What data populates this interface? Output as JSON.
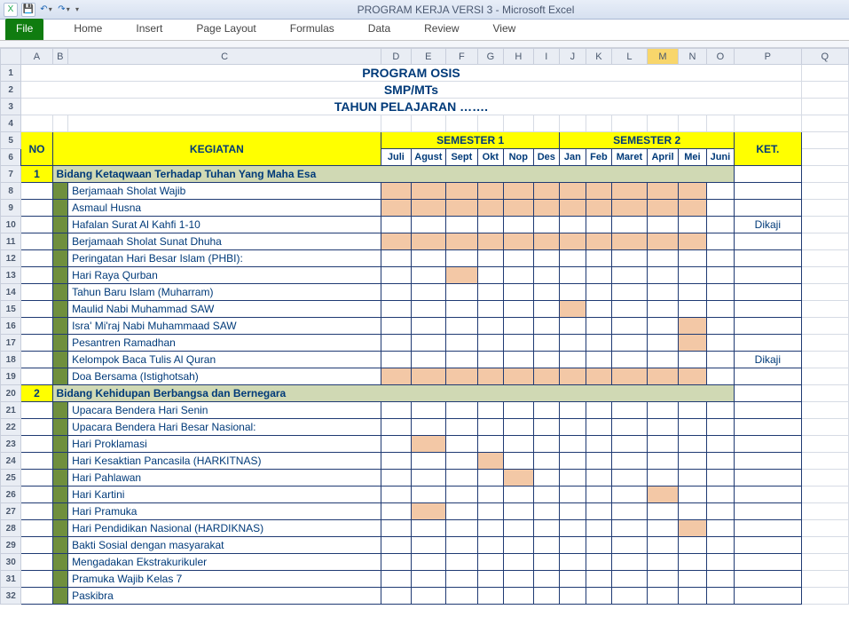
{
  "window": {
    "title": "PROGRAM KERJA VERSI 3  -  Microsoft Excel"
  },
  "ribbon": {
    "tabs": {
      "file": "File",
      "home": "Home",
      "insert": "Insert",
      "pageLayout": "Page Layout",
      "formulas": "Formulas",
      "data": "Data",
      "review": "Review",
      "view": "View"
    }
  },
  "cols": [
    "A",
    "B",
    "C",
    "D",
    "E",
    "F",
    "G",
    "H",
    "I",
    "J",
    "K",
    "L",
    "M",
    "N",
    "O",
    "P",
    "Q"
  ],
  "selectedCol": "M",
  "title1": "PROGRAM OSIS",
  "title2": "SMP/MTs",
  "title3": "TAHUN PELAJARAN …….",
  "headers": {
    "no": "NO",
    "kegiatan": "KEGIATAN",
    "sem1": "SEMESTER 1",
    "sem2": "SEMESTER 2",
    "ket": "KET.",
    "months": [
      "Juli",
      "Agust",
      "Sept",
      "Okt",
      "Nop",
      "Des",
      "Jan",
      "Feb",
      "Maret",
      "April",
      "Mei",
      "Juni"
    ]
  },
  "sections": [
    {
      "no": "1",
      "title": "Bidang Ketaqwaan Terhadap Tuhan Yang Maha Esa"
    },
    {
      "no": "2",
      "title": "Bidang Kehidupan Berbangsa dan Bernegara"
    }
  ],
  "rows": [
    {
      "r": 8,
      "sec": 0,
      "txt": "Berjamaah Sholat Wajib",
      "m": [
        1,
        1,
        1,
        1,
        1,
        1,
        1,
        1,
        1,
        1,
        1,
        0
      ],
      "ket": ""
    },
    {
      "r": 9,
      "sec": 0,
      "txt": "Asmaul Husna",
      "m": [
        1,
        1,
        1,
        1,
        1,
        1,
        1,
        1,
        1,
        1,
        1,
        0
      ],
      "ket": ""
    },
    {
      "r": 10,
      "sec": 0,
      "txt": "Hafalan Surat Al Kahfi 1-10",
      "m": [
        0,
        0,
        0,
        0,
        0,
        0,
        0,
        0,
        0,
        0,
        0,
        0
      ],
      "ket": "Dikaji"
    },
    {
      "r": 11,
      "sec": 0,
      "txt": "Berjamaah Sholat Sunat Dhuha",
      "m": [
        1,
        1,
        1,
        1,
        1,
        1,
        1,
        1,
        1,
        1,
        1,
        0
      ],
      "ket": ""
    },
    {
      "r": 12,
      "sec": 0,
      "txt": "Peringatan Hari Besar Islam (PHBI):",
      "m": [
        0,
        0,
        0,
        0,
        0,
        0,
        0,
        0,
        0,
        0,
        0,
        0
      ],
      "ket": ""
    },
    {
      "r": 13,
      "sec": 0,
      "txt": "Hari Raya Qurban",
      "m": [
        0,
        0,
        1,
        0,
        0,
        0,
        0,
        0,
        0,
        0,
        0,
        0
      ],
      "ket": ""
    },
    {
      "r": 14,
      "sec": 0,
      "txt": "Tahun Baru Islam (Muharram)",
      "m": [
        0,
        0,
        0,
        0,
        0,
        0,
        0,
        0,
        0,
        0,
        0,
        0
      ],
      "ket": ""
    },
    {
      "r": 15,
      "sec": 0,
      "txt": "Maulid Nabi Muhammad SAW",
      "m": [
        0,
        0,
        0,
        0,
        0,
        0,
        1,
        0,
        0,
        0,
        0,
        0
      ],
      "ket": ""
    },
    {
      "r": 16,
      "sec": 0,
      "txt": "Isra' Mi'raj Nabi Muhammaad SAW",
      "m": [
        0,
        0,
        0,
        0,
        0,
        0,
        0,
        0,
        0,
        0,
        1,
        0
      ],
      "ket": ""
    },
    {
      "r": 17,
      "sec": 0,
      "txt": "Pesantren Ramadhan",
      "m": [
        0,
        0,
        0,
        0,
        0,
        0,
        0,
        0,
        0,
        0,
        1,
        0
      ],
      "ket": ""
    },
    {
      "r": 18,
      "sec": 0,
      "txt": "Kelompok Baca Tulis Al Quran",
      "m": [
        0,
        0,
        0,
        0,
        0,
        0,
        0,
        0,
        0,
        0,
        0,
        0
      ],
      "ket": "Dikaji"
    },
    {
      "r": 19,
      "sec": 0,
      "txt": "Doa Bersama (Istighotsah)",
      "m": [
        1,
        1,
        1,
        1,
        1,
        1,
        1,
        1,
        1,
        1,
        1,
        0
      ],
      "ket": ""
    },
    {
      "r": 21,
      "sec": 1,
      "txt": "Upacara Bendera Hari Senin",
      "m": [
        0,
        0,
        0,
        0,
        0,
        0,
        0,
        0,
        0,
        0,
        0,
        0
      ],
      "ket": ""
    },
    {
      "r": 22,
      "sec": 1,
      "txt": "Upacara Bendera Hari Besar Nasional:",
      "m": [
        0,
        0,
        0,
        0,
        0,
        0,
        0,
        0,
        0,
        0,
        0,
        0
      ],
      "ket": ""
    },
    {
      "r": 23,
      "sec": 1,
      "txt": "Hari Proklamasi",
      "m": [
        0,
        1,
        0,
        0,
        0,
        0,
        0,
        0,
        0,
        0,
        0,
        0
      ],
      "ket": ""
    },
    {
      "r": 24,
      "sec": 1,
      "txt": "Hari Kesaktian Pancasila (HARKITNAS)",
      "m": [
        0,
        0,
        0,
        1,
        0,
        0,
        0,
        0,
        0,
        0,
        0,
        0
      ],
      "ket": ""
    },
    {
      "r": 25,
      "sec": 1,
      "txt": "Hari Pahlawan",
      "m": [
        0,
        0,
        0,
        0,
        1,
        0,
        0,
        0,
        0,
        0,
        0,
        0
      ],
      "ket": ""
    },
    {
      "r": 26,
      "sec": 1,
      "txt": "Hari Kartini",
      "m": [
        0,
        0,
        0,
        0,
        0,
        0,
        0,
        0,
        0,
        1,
        0,
        0
      ],
      "ket": ""
    },
    {
      "r": 27,
      "sec": 1,
      "txt": "Hari Pramuka",
      "m": [
        0,
        1,
        0,
        0,
        0,
        0,
        0,
        0,
        0,
        0,
        0,
        0
      ],
      "ket": ""
    },
    {
      "r": 28,
      "sec": 1,
      "txt": "Hari Pendidikan Nasional (HARDIKNAS)",
      "m": [
        0,
        0,
        0,
        0,
        0,
        0,
        0,
        0,
        0,
        0,
        1,
        0
      ],
      "ket": ""
    },
    {
      "r": 29,
      "sec": 1,
      "txt": "Bakti Sosial dengan masyarakat",
      "m": [
        0,
        0,
        0,
        0,
        0,
        0,
        0,
        0,
        0,
        0,
        0,
        0
      ],
      "ket": ""
    },
    {
      "r": 30,
      "sec": 1,
      "txt": "Mengadakan Ekstrakurikuler",
      "m": [
        0,
        0,
        0,
        0,
        0,
        0,
        0,
        0,
        0,
        0,
        0,
        0
      ],
      "ket": ""
    },
    {
      "r": 31,
      "sec": 1,
      "txt": "Pramuka Wajib Kelas 7",
      "m": [
        0,
        0,
        0,
        0,
        0,
        0,
        0,
        0,
        0,
        0,
        0,
        0
      ],
      "ket": ""
    },
    {
      "r": 32,
      "sec": 1,
      "txt": "Paskibra",
      "m": [
        0,
        0,
        0,
        0,
        0,
        0,
        0,
        0,
        0,
        0,
        0,
        0
      ],
      "ket": ""
    }
  ]
}
